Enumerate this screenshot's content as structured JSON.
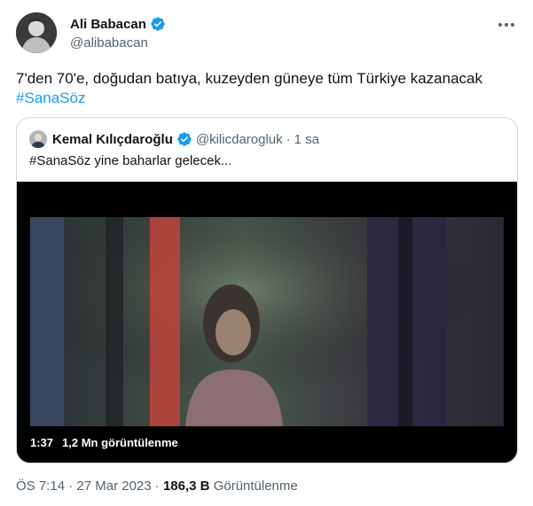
{
  "author": {
    "name": "Ali Babacan",
    "handle": "@alibabacan",
    "verified": true
  },
  "tweet": {
    "text": "7'den 70'e, doğudan batıya, kuzeyden güneye tüm Türkiye kazanacak",
    "hashtag": "#SanaSöz"
  },
  "quoted_tweet": {
    "name": "Kemal Kılıçdaroğlu",
    "handle": "@kilicdarogluk",
    "separator": "·",
    "time": "1 sa",
    "text": "#SanaSöz yine baharlar gelecek...",
    "video": {
      "duration": "1:37",
      "views": "1,2 Mn görüntülenme"
    }
  },
  "meta": {
    "time": "ÖS 7:14",
    "separator1": "·",
    "date": "27 Mar 2023",
    "separator2": "·",
    "views_count": "186,3 B",
    "views_label": "Görüntülenme"
  },
  "colors": {
    "accent": "#1d9bf0",
    "text": "#0f1419",
    "secondary": "#536471",
    "border": "#cfd9de"
  },
  "icons": [
    "verified-badge-icon",
    "more-options-icon"
  ]
}
